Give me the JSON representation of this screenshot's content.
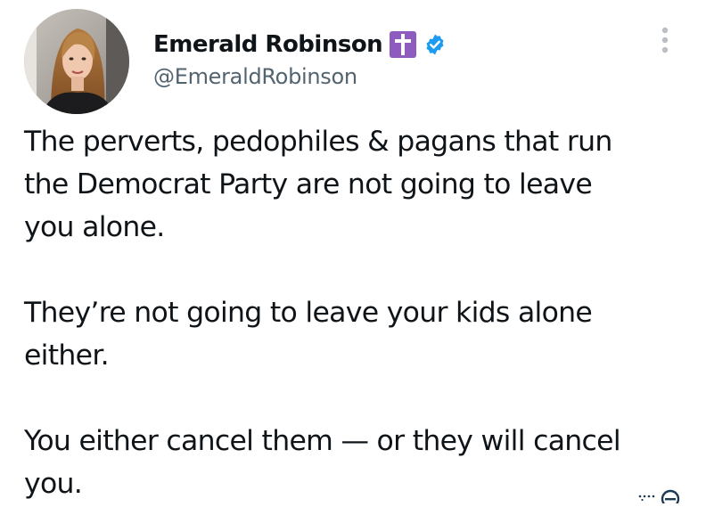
{
  "author": {
    "display_name": "Emerald Robinson",
    "handle": "@EmeraldRobinson",
    "cross_badge_icon": "latin-cross-icon",
    "cross_badge_color": "#8e5bbf",
    "verified_icon": "verified-badge-icon",
    "verified_color": "#1d9bf0"
  },
  "tweet": {
    "paragraphs": [
      "The perverts, pedophiles & pagans that run\nthe Democrat Party are not going to leave\nyou alone.",
      "They’re not going to leave your kids alone\neither.",
      "You either cancel them — or they will cancel\nyou."
    ]
  },
  "colors": {
    "text": "#0f1419",
    "secondary_text": "#536471",
    "background": "#ffffff"
  },
  "icons": {
    "more": "more-vertical-icon",
    "corner": "dotted-circle-icon"
  }
}
